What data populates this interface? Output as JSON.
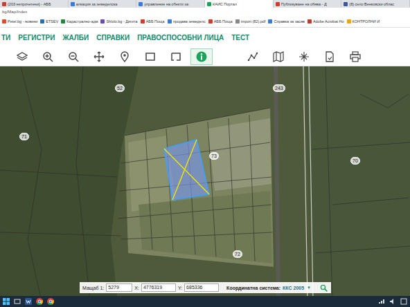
{
  "browser": {
    "tabs": [
      {
        "label": "(203 непрочетени) - АББ",
        "selected": false,
        "color": "#d23c2c"
      },
      {
        "label": "алкация за земеделска",
        "selected": false,
        "color": "#3a7bd5"
      },
      {
        "label": "управление на обекти за",
        "selected": false,
        "color": "#3a7bd5"
      },
      {
        "label": "КАИС Портал",
        "selected": true,
        "color": "#1aa35a"
      },
      {
        "label": "Публикуване на обява - Д",
        "selected": false,
        "color": "#d23c2c"
      },
      {
        "label": "(8) село Венковски облас",
        "selected": false,
        "color": "#3b5998"
      }
    ],
    "address": "bg/Map/Index",
    "bookmarks": [
      "Petel.bg - новини",
      "ETSEV",
      "Кадастрално-адм",
      "Shlolo.bg - Дигита",
      "АББ Поща",
      "продава земеделс",
      "АББ Поща",
      "import (82).pdf",
      "Справка за засяв",
      "Adobe Acrobat Ho",
      "КОНТРОЛНИ И"
    ]
  },
  "menu": [
    "ТИ",
    "РЕГИСТРИ",
    "ЖАЛБИ",
    "СПРАВКИ",
    "ПРАВОСПОСОБНИ ЛИЦА",
    "ТЕСТ"
  ],
  "toolbar": [
    {
      "selected": false
    },
    {
      "selected": false
    },
    {
      "selected": false
    },
    {
      "selected": false
    },
    {
      "selected": false
    },
    {
      "selected": false
    },
    {
      "selected": false
    },
    {
      "selected": true
    },
    {
      "selected": false
    },
    {
      "selected": false
    },
    {
      "selected": false
    },
    {
      "selected": false
    },
    {
      "selected": false
    }
  ],
  "map": {
    "parcel_labels": [
      "52",
      "243",
      "71",
      "73",
      "70",
      "72"
    ],
    "selected_parcel": {
      "selected": true
    }
  },
  "status_bar": {
    "scale_label": "Мащаб 1:",
    "scale": "5279",
    "x_label": "X:",
    "x": "4776319",
    "y_label": "Y:",
    "y": "685336",
    "crs_label": "Координатна система:",
    "crs": "ККС 2005",
    "crs_arrow": "▼"
  }
}
